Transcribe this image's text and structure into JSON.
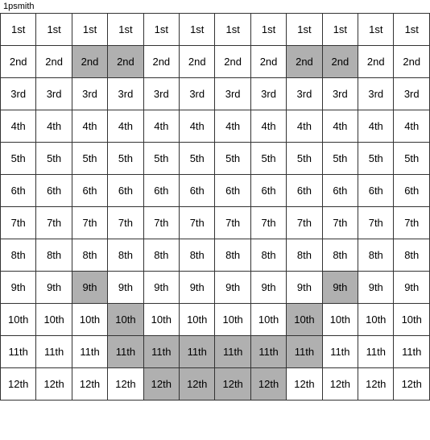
{
  "title": "1psmith",
  "grid": {
    "rows": [
      {
        "label": "1st",
        "cells": [
          {
            "text": "1st",
            "highlight": false
          },
          {
            "text": "1st",
            "highlight": false
          },
          {
            "text": "1st",
            "highlight": false
          },
          {
            "text": "1st",
            "highlight": false
          },
          {
            "text": "1st",
            "highlight": false
          },
          {
            "text": "1st",
            "highlight": false
          },
          {
            "text": "1st",
            "highlight": false
          },
          {
            "text": "1st",
            "highlight": false
          },
          {
            "text": "1st",
            "highlight": false
          },
          {
            "text": "1st",
            "highlight": false
          },
          {
            "text": "1st",
            "highlight": false
          },
          {
            "text": "1st",
            "highlight": false
          }
        ]
      },
      {
        "label": "2nd",
        "cells": [
          {
            "text": "2nd",
            "highlight": false
          },
          {
            "text": "2nd",
            "highlight": false
          },
          {
            "text": "2nd",
            "highlight": true
          },
          {
            "text": "2nd",
            "highlight": true
          },
          {
            "text": "2nd",
            "highlight": false
          },
          {
            "text": "2nd",
            "highlight": false
          },
          {
            "text": "2nd",
            "highlight": false
          },
          {
            "text": "2nd",
            "highlight": false
          },
          {
            "text": "2nd",
            "highlight": true
          },
          {
            "text": "2nd",
            "highlight": true
          },
          {
            "text": "2nd",
            "highlight": false
          },
          {
            "text": "2nd",
            "highlight": false
          }
        ]
      },
      {
        "label": "3rd",
        "cells": [
          {
            "text": "3rd",
            "highlight": false
          },
          {
            "text": "3rd",
            "highlight": false
          },
          {
            "text": "3rd",
            "highlight": false
          },
          {
            "text": "3rd",
            "highlight": false
          },
          {
            "text": "3rd",
            "highlight": false
          },
          {
            "text": "3rd",
            "highlight": false
          },
          {
            "text": "3rd",
            "highlight": false
          },
          {
            "text": "3rd",
            "highlight": false
          },
          {
            "text": "3rd",
            "highlight": false
          },
          {
            "text": "3rd",
            "highlight": false
          },
          {
            "text": "3rd",
            "highlight": false
          },
          {
            "text": "3rd",
            "highlight": false
          }
        ]
      },
      {
        "label": "4th",
        "cells": [
          {
            "text": "4th",
            "highlight": false
          },
          {
            "text": "4th",
            "highlight": false
          },
          {
            "text": "4th",
            "highlight": false
          },
          {
            "text": "4th",
            "highlight": false
          },
          {
            "text": "4th",
            "highlight": false
          },
          {
            "text": "4th",
            "highlight": false
          },
          {
            "text": "4th",
            "highlight": false
          },
          {
            "text": "4th",
            "highlight": false
          },
          {
            "text": "4th",
            "highlight": false
          },
          {
            "text": "4th",
            "highlight": false
          },
          {
            "text": "4th",
            "highlight": false
          },
          {
            "text": "4th",
            "highlight": false
          }
        ]
      },
      {
        "label": "5th",
        "cells": [
          {
            "text": "5th",
            "highlight": false
          },
          {
            "text": "5th",
            "highlight": false
          },
          {
            "text": "5th",
            "highlight": false
          },
          {
            "text": "5th",
            "highlight": false
          },
          {
            "text": "5th",
            "highlight": false
          },
          {
            "text": "5th",
            "highlight": false
          },
          {
            "text": "5th",
            "highlight": false
          },
          {
            "text": "5th",
            "highlight": false
          },
          {
            "text": "5th",
            "highlight": false
          },
          {
            "text": "5th",
            "highlight": false
          },
          {
            "text": "5th",
            "highlight": false
          },
          {
            "text": "5th",
            "highlight": false
          }
        ]
      },
      {
        "label": "6th",
        "cells": [
          {
            "text": "6th",
            "highlight": false
          },
          {
            "text": "6th",
            "highlight": false
          },
          {
            "text": "6th",
            "highlight": false
          },
          {
            "text": "6th",
            "highlight": false
          },
          {
            "text": "6th",
            "highlight": false
          },
          {
            "text": "6th",
            "highlight": false
          },
          {
            "text": "6th",
            "highlight": false
          },
          {
            "text": "6th",
            "highlight": false
          },
          {
            "text": "6th",
            "highlight": false
          },
          {
            "text": "6th",
            "highlight": false
          },
          {
            "text": "6th",
            "highlight": false
          },
          {
            "text": "6th",
            "highlight": false
          }
        ]
      },
      {
        "label": "7th",
        "cells": [
          {
            "text": "7th",
            "highlight": false
          },
          {
            "text": "7th",
            "highlight": false
          },
          {
            "text": "7th",
            "highlight": false
          },
          {
            "text": "7th",
            "highlight": false
          },
          {
            "text": "7th",
            "highlight": false
          },
          {
            "text": "7th",
            "highlight": false
          },
          {
            "text": "7th",
            "highlight": false
          },
          {
            "text": "7th",
            "highlight": false
          },
          {
            "text": "7th",
            "highlight": false
          },
          {
            "text": "7th",
            "highlight": false
          },
          {
            "text": "7th",
            "highlight": false
          },
          {
            "text": "7th",
            "highlight": false
          }
        ]
      },
      {
        "label": "8th",
        "cells": [
          {
            "text": "8th",
            "highlight": false
          },
          {
            "text": "8th",
            "highlight": false
          },
          {
            "text": "8th",
            "highlight": false
          },
          {
            "text": "8th",
            "highlight": false
          },
          {
            "text": "8th",
            "highlight": false
          },
          {
            "text": "8th",
            "highlight": false
          },
          {
            "text": "8th",
            "highlight": false
          },
          {
            "text": "8th",
            "highlight": false
          },
          {
            "text": "8th",
            "highlight": false
          },
          {
            "text": "8th",
            "highlight": false
          },
          {
            "text": "8th",
            "highlight": false
          },
          {
            "text": "8th",
            "highlight": false
          }
        ]
      },
      {
        "label": "9th",
        "cells": [
          {
            "text": "9th",
            "highlight": false
          },
          {
            "text": "9th",
            "highlight": false
          },
          {
            "text": "9th",
            "highlight": true
          },
          {
            "text": "9th",
            "highlight": false
          },
          {
            "text": "9th",
            "highlight": false
          },
          {
            "text": "9th",
            "highlight": false
          },
          {
            "text": "9th",
            "highlight": false
          },
          {
            "text": "9th",
            "highlight": false
          },
          {
            "text": "9th",
            "highlight": false
          },
          {
            "text": "9th",
            "highlight": true
          },
          {
            "text": "9th",
            "highlight": false
          },
          {
            "text": "9th",
            "highlight": false
          }
        ]
      },
      {
        "label": "10th",
        "cells": [
          {
            "text": "10th",
            "highlight": false
          },
          {
            "text": "10th",
            "highlight": false
          },
          {
            "text": "10th",
            "highlight": false
          },
          {
            "text": "10th",
            "highlight": true
          },
          {
            "text": "10th",
            "highlight": false
          },
          {
            "text": "10th",
            "highlight": false
          },
          {
            "text": "10th",
            "highlight": false
          },
          {
            "text": "10th",
            "highlight": false
          },
          {
            "text": "10th",
            "highlight": true
          },
          {
            "text": "10th",
            "highlight": false
          },
          {
            "text": "10th",
            "highlight": false
          },
          {
            "text": "10th",
            "highlight": false
          }
        ]
      },
      {
        "label": "11th",
        "cells": [
          {
            "text": "11th",
            "highlight": false
          },
          {
            "text": "11th",
            "highlight": false
          },
          {
            "text": "11th",
            "highlight": false
          },
          {
            "text": "11th",
            "highlight": true
          },
          {
            "text": "11th",
            "highlight": true
          },
          {
            "text": "11th",
            "highlight": true
          },
          {
            "text": "11th",
            "highlight": true
          },
          {
            "text": "11th",
            "highlight": true
          },
          {
            "text": "11th",
            "highlight": true
          },
          {
            "text": "11th",
            "highlight": false
          },
          {
            "text": "11th",
            "highlight": false
          },
          {
            "text": "11th",
            "highlight": false
          }
        ]
      },
      {
        "label": "12th",
        "cells": [
          {
            "text": "12th",
            "highlight": false
          },
          {
            "text": "12th",
            "highlight": false
          },
          {
            "text": "12th",
            "highlight": false
          },
          {
            "text": "12th",
            "highlight": false
          },
          {
            "text": "12th",
            "highlight": true
          },
          {
            "text": "12th",
            "highlight": true
          },
          {
            "text": "12th",
            "highlight": true
          },
          {
            "text": "12th",
            "highlight": true
          },
          {
            "text": "12th",
            "highlight": false
          },
          {
            "text": "12th",
            "highlight": false
          },
          {
            "text": "12th",
            "highlight": false
          },
          {
            "text": "12th",
            "highlight": false
          }
        ]
      }
    ]
  }
}
